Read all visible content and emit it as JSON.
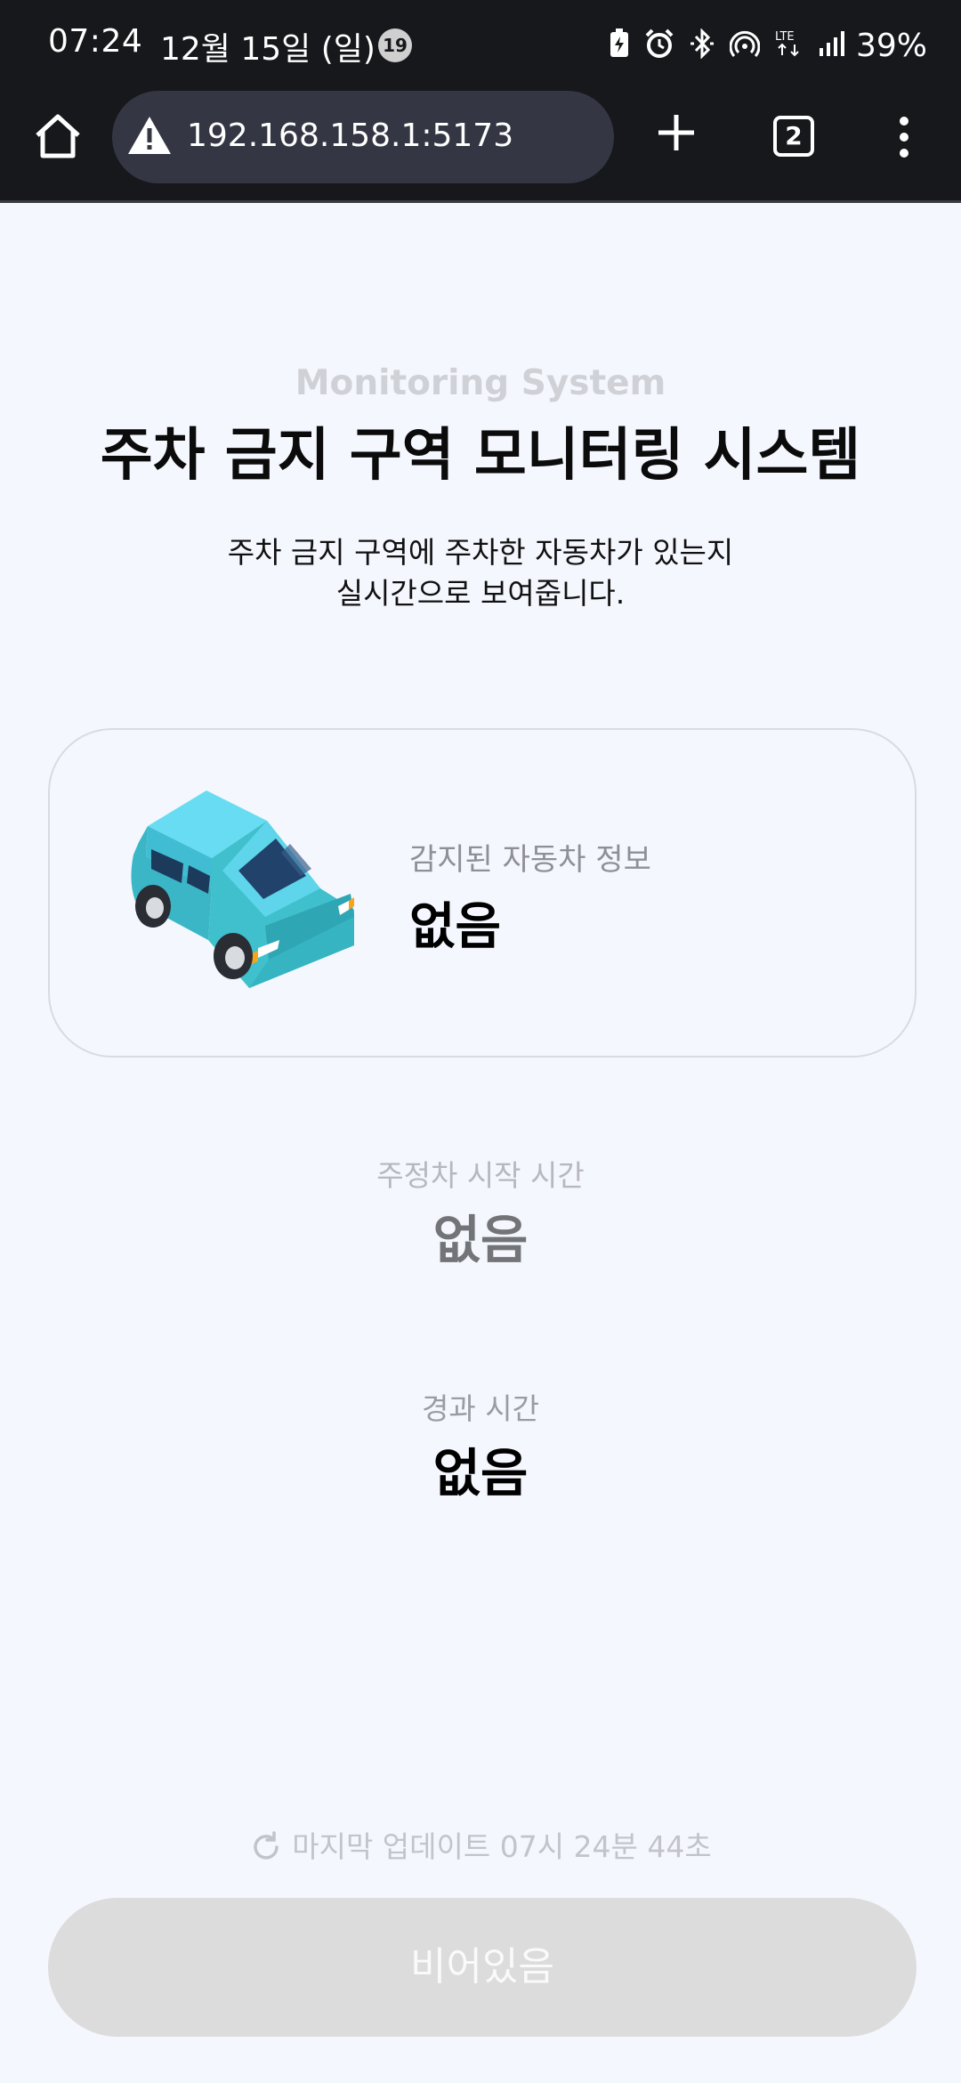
{
  "status_bar": {
    "time": "07:24",
    "date": "12월 15일 (일)",
    "notification_count": "19",
    "network": "LTE",
    "battery": "39%"
  },
  "browser": {
    "url": "192.168.158.1:5173",
    "tab_count": "2",
    "icons": [
      "home-icon",
      "warning-icon",
      "new-tab-icon",
      "tab-switcher-icon",
      "menu-icon"
    ]
  },
  "header": {
    "eyebrow": "Monitoring System",
    "title": "주차 금지 구역 모니터링 시스템",
    "description_line1": "주차 금지 구역에 주차한 자동차가 있는지",
    "description_line2": "실시간으로 보여줍니다."
  },
  "detected_car": {
    "label": "감지된 자동차 정보",
    "value": "없음"
  },
  "parking_start": {
    "label": "주정차 시작 시간",
    "value": "없음"
  },
  "elapsed": {
    "label": "경과 시간",
    "value": "없음"
  },
  "footer": {
    "last_update": "마지막 업데이트 07시 24분 44초",
    "status_button": "비어있음"
  },
  "colors": {
    "background": "#f5f7fe",
    "browser_chrome": "#17181c",
    "urlbar": "#343743",
    "car_body": "#4fd0e3",
    "button_disabled": "#dcdcdc"
  }
}
